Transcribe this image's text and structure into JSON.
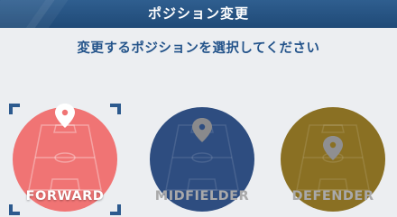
{
  "header": {
    "title": "ポジション変更"
  },
  "instruction": "変更するポジションを選択してください",
  "positions": [
    {
      "label": "FORWARD",
      "selected": true,
      "color": "#f07474",
      "pin": "#ffffff"
    },
    {
      "label": "MIDFIELDER",
      "selected": false,
      "color": "#2e4d80",
      "pin": "#8a8a8c"
    },
    {
      "label": "DEFENDER",
      "selected": false,
      "color": "#8a7023",
      "pin": "#8f8f91"
    }
  ],
  "colors": {
    "header": "#27558a",
    "accent": "#23538a",
    "bracket": "#2d5a8e"
  }
}
